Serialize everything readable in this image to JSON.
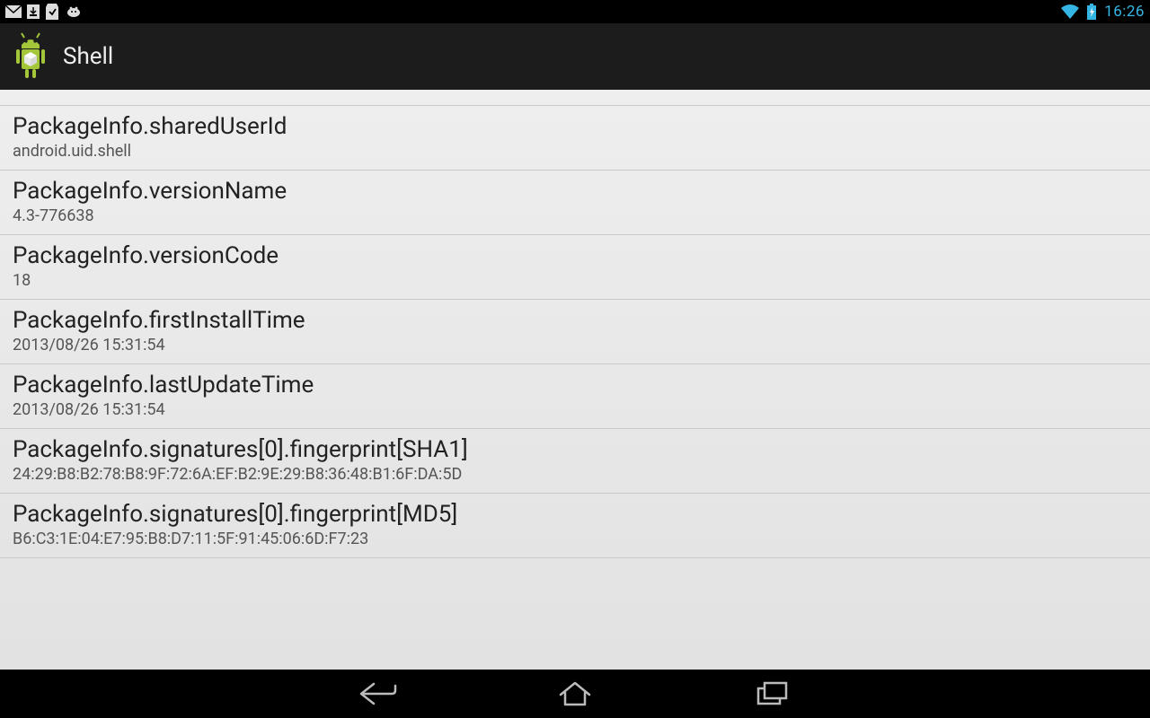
{
  "status": {
    "time": "16:26"
  },
  "actionbar": {
    "title": "Shell"
  },
  "rows": [
    {
      "title": "PackageInfo.sharedUserId",
      "value": "android.uid.shell"
    },
    {
      "title": "PackageInfo.versionName",
      "value": "4.3-776638"
    },
    {
      "title": "PackageInfo.versionCode",
      "value": "18"
    },
    {
      "title": "PackageInfo.firstInstallTime",
      "value": "2013/08/26 15:31:54"
    },
    {
      "title": "PackageInfo.lastUpdateTime",
      "value": "2013/08/26 15:31:54"
    },
    {
      "title": "PackageInfo.signatures[0].fingerprint[SHA1]",
      "value": "24:29:B8:B2:78:B8:9F:72:6A:EF:B2:9E:29:B8:36:48:B1:6F:DA:5D"
    },
    {
      "title": "PackageInfo.signatures[0].fingerprint[MD5]",
      "value": "B6:C3:1E:04:E7:95:B8:D7:11:5F:91:45:06:6D:F7:23"
    }
  ]
}
